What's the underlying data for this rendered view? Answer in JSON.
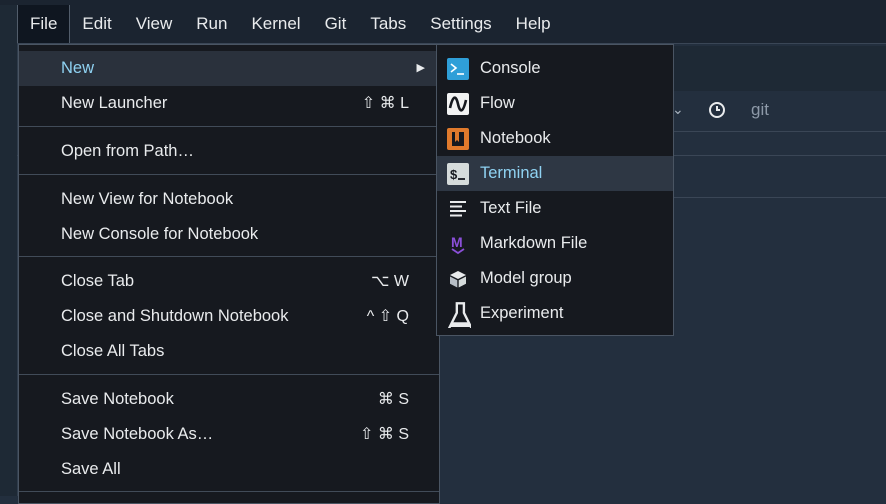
{
  "menubar": {
    "items": [
      "File",
      "Edit",
      "View",
      "Run",
      "Kernel",
      "Git",
      "Tabs",
      "Settings",
      "Help"
    ]
  },
  "toolbar": {
    "git_label": "git",
    "icons": [
      "chevron-down-icon",
      "clock-icon"
    ]
  },
  "file_menu": {
    "new": {
      "label": "New"
    },
    "new_launcher": {
      "label": "New Launcher",
      "shortcut": "⇧ ⌘ L"
    },
    "open_from_path": {
      "label": "Open from Path…"
    },
    "new_view_for_notebook": {
      "label": "New View for Notebook"
    },
    "new_console_for_notebook": {
      "label": "New Console for Notebook"
    },
    "close_tab": {
      "label": "Close Tab",
      "shortcut": "⌥ W"
    },
    "close_and_shutdown": {
      "label": "Close and Shutdown Notebook",
      "shortcut": "^ ⇧ Q"
    },
    "close_all_tabs": {
      "label": "Close All Tabs"
    },
    "save_notebook": {
      "label": "Save Notebook",
      "shortcut": "⌘ S"
    },
    "save_notebook_as": {
      "label": "Save Notebook As…",
      "shortcut": "⇧ ⌘ S"
    },
    "save_all": {
      "label": "Save All"
    }
  },
  "new_submenu": {
    "items": [
      {
        "label": "Console",
        "icon": "console-icon"
      },
      {
        "label": "Flow",
        "icon": "flow-icon"
      },
      {
        "label": "Notebook",
        "icon": "notebook-icon"
      },
      {
        "label": "Terminal",
        "icon": "terminal-icon"
      },
      {
        "label": "Text File",
        "icon": "text-file-icon"
      },
      {
        "label": "Markdown File",
        "icon": "markdown-icon"
      },
      {
        "label": "Model group",
        "icon": "model-group-icon"
      },
      {
        "label": "Experiment",
        "icon": "experiment-icon"
      }
    ]
  },
  "colors": {
    "highlight_text": "#8fd2f2",
    "console_icon": "#2f9fd8",
    "notebook_icon": "#e07a2c",
    "markdown_icon": "#8a4fd8"
  }
}
